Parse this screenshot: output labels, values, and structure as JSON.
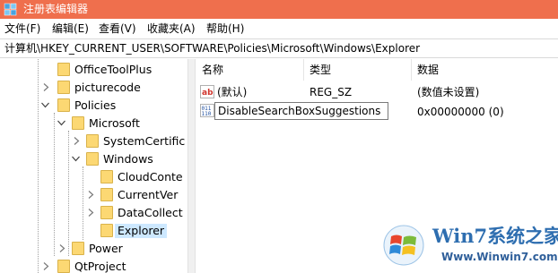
{
  "window": {
    "title": "注册表编辑器"
  },
  "menu": {
    "items": [
      "文件(F)",
      "编辑(E)",
      "查看(V)",
      "收藏夹(A)",
      "帮助(H)"
    ]
  },
  "address": {
    "path": "计算机\\HKEY_CURRENT_USER\\SOFTWARE\\Policies\\Microsoft\\Windows\\Explorer"
  },
  "tree": {
    "items": [
      {
        "label": "OfficeToolPlus",
        "state": "none"
      },
      {
        "label": "picturecode",
        "state": "collapsed"
      },
      {
        "label": "Policies",
        "state": "expanded"
      },
      {
        "label": "Microsoft",
        "state": "expanded"
      },
      {
        "label": "SystemCertific",
        "state": "collapsed"
      },
      {
        "label": "Windows",
        "state": "expanded"
      },
      {
        "label": "CloudConte",
        "state": "none"
      },
      {
        "label": "CurrentVer",
        "state": "collapsed"
      },
      {
        "label": "DataCollect",
        "state": "collapsed"
      },
      {
        "label": "Explorer",
        "state": "selected"
      },
      {
        "label": "Power",
        "state": "collapsed"
      },
      {
        "label": "QtProject",
        "state": "collapsed"
      }
    ]
  },
  "list": {
    "columns": [
      "名称",
      "类型",
      "数据"
    ],
    "rows": [
      {
        "icon": "string-value-icon",
        "name": "(默认)",
        "type": "REG_SZ",
        "data": "(数值未设置)"
      },
      {
        "icon": "binary-value-icon",
        "name": "DisableSearchBoxSuggestions",
        "type": "",
        "data": "0x00000000 (0)",
        "renaming": true
      }
    ]
  },
  "watermark": {
    "title": "Win7系统之家",
    "url": "Www.Winwin7.com"
  },
  "colors": {
    "titlebar": "#ef6f4d",
    "folder": "#fcd873",
    "selection": "#cde8ff"
  }
}
